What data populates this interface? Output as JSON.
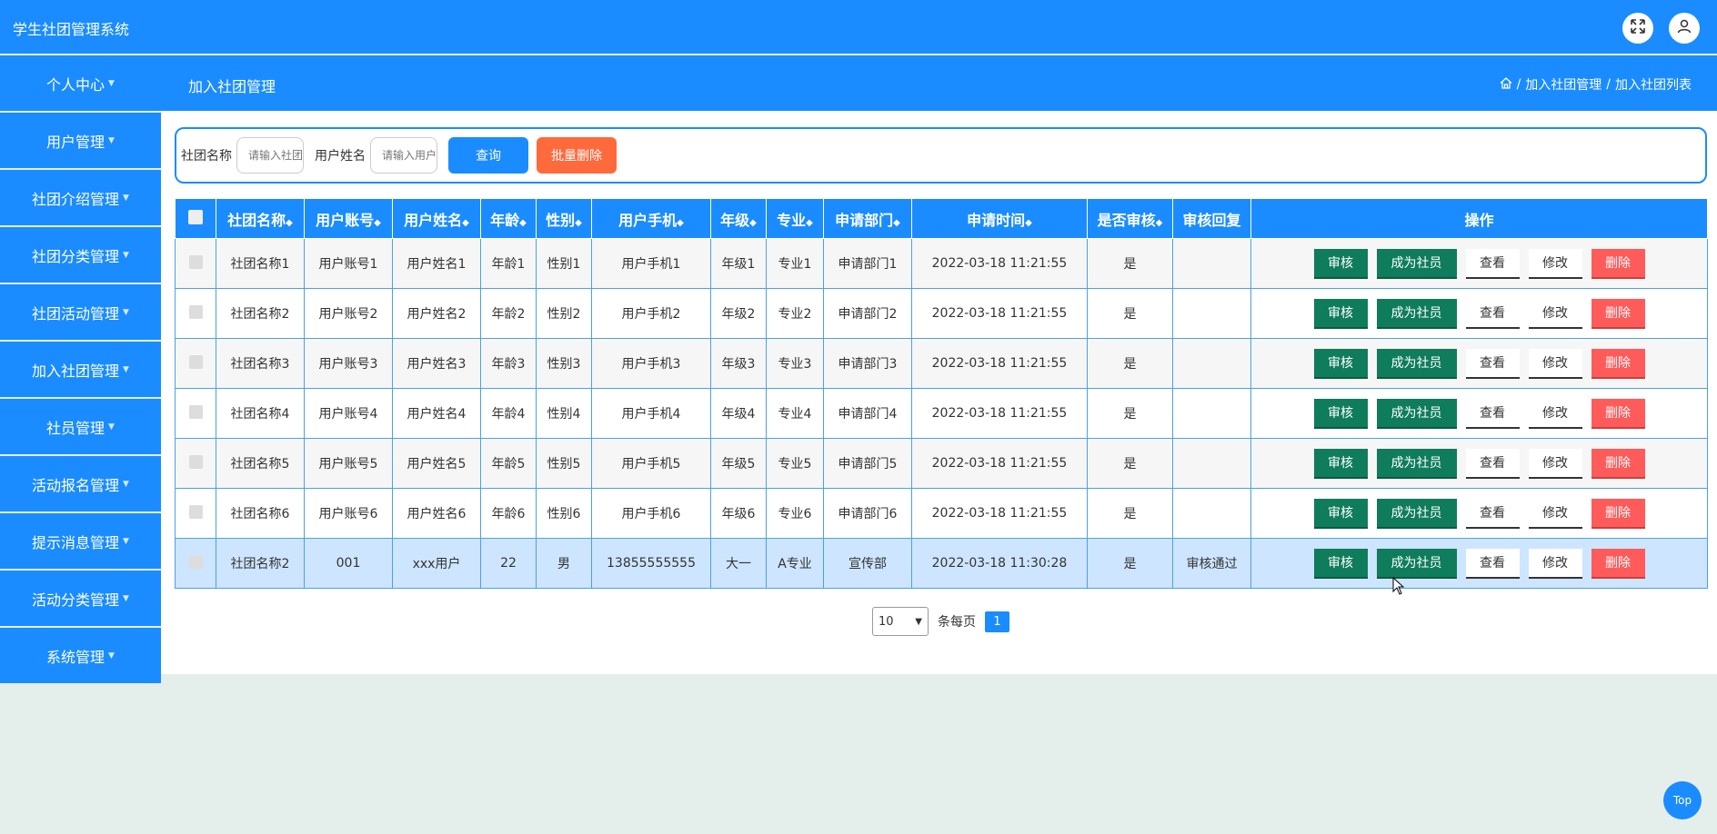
{
  "app": {
    "title": "学生社团管理系统"
  },
  "sidebar": {
    "items": [
      {
        "label": "个人中心"
      },
      {
        "label": "用户管理"
      },
      {
        "label": "社团介绍管理"
      },
      {
        "label": "社团分类管理"
      },
      {
        "label": "社团活动管理"
      },
      {
        "label": "加入社团管理"
      },
      {
        "label": "社员管理"
      },
      {
        "label": "活动报名管理"
      },
      {
        "label": "提示消息管理"
      },
      {
        "label": "活动分类管理"
      },
      {
        "label": "系统管理"
      }
    ]
  },
  "header": {
    "section": "加入社团管理",
    "breadcrumbs": [
      "加入社团管理",
      "加入社团列表"
    ],
    "separator": "/"
  },
  "search": {
    "club_label": "社团名称",
    "club_placeholder": "请输入社团名称",
    "user_label": "用户姓名",
    "user_placeholder": "请输入用户姓名",
    "query_label": "查询",
    "batch_delete_label": "批量删除"
  },
  "table": {
    "columns": [
      "社团名称",
      "用户账号",
      "用户姓名",
      "年龄",
      "性别",
      "用户手机",
      "年级",
      "专业",
      "申请部门",
      "申请时间",
      "是否审核",
      "审核回复",
      "操作"
    ],
    "rows": [
      [
        "社团名称1",
        "用户账号1",
        "用户姓名1",
        "年龄1",
        "性别1",
        "用户手机1",
        "年级1",
        "专业1",
        "申请部门1",
        "2022-03-18 11:21:55",
        "是",
        ""
      ],
      [
        "社团名称2",
        "用户账号2",
        "用户姓名2",
        "年龄2",
        "性别2",
        "用户手机2",
        "年级2",
        "专业2",
        "申请部门2",
        "2022-03-18 11:21:55",
        "是",
        ""
      ],
      [
        "社团名称3",
        "用户账号3",
        "用户姓名3",
        "年龄3",
        "性别3",
        "用户手机3",
        "年级3",
        "专业3",
        "申请部门3",
        "2022-03-18 11:21:55",
        "是",
        ""
      ],
      [
        "社团名称4",
        "用户账号4",
        "用户姓名4",
        "年龄4",
        "性别4",
        "用户手机4",
        "年级4",
        "专业4",
        "申请部门4",
        "2022-03-18 11:21:55",
        "是",
        ""
      ],
      [
        "社团名称5",
        "用户账号5",
        "用户姓名5",
        "年龄5",
        "性别5",
        "用户手机5",
        "年级5",
        "专业5",
        "申请部门5",
        "2022-03-18 11:21:55",
        "是",
        ""
      ],
      [
        "社团名称6",
        "用户账号6",
        "用户姓名6",
        "年龄6",
        "性别6",
        "用户手机6",
        "年级6",
        "专业6",
        "申请部门6",
        "2022-03-18 11:21:55",
        "是",
        ""
      ],
      [
        "社团名称2",
        "001",
        "xxx用户",
        "22",
        "男",
        "13855555555",
        "大一",
        "A专业",
        "宣传部",
        "2022-03-18 11:30:28",
        "是",
        "审核通过"
      ]
    ],
    "actions": {
      "review": "审核",
      "become_member": "成为社员",
      "view": "查看",
      "edit": "修改",
      "delete": "删除"
    }
  },
  "pagination": {
    "page_size": "10",
    "per_page_label": "条每页",
    "current_page": "1"
  },
  "top_button": {
    "label": "Top"
  },
  "colors": {
    "primary": "#1a8cff",
    "success": "#0f7c5c",
    "danger": "#ff5b5b",
    "batch_delete": "#ff6a3d",
    "page_bg": "#e4efec"
  }
}
